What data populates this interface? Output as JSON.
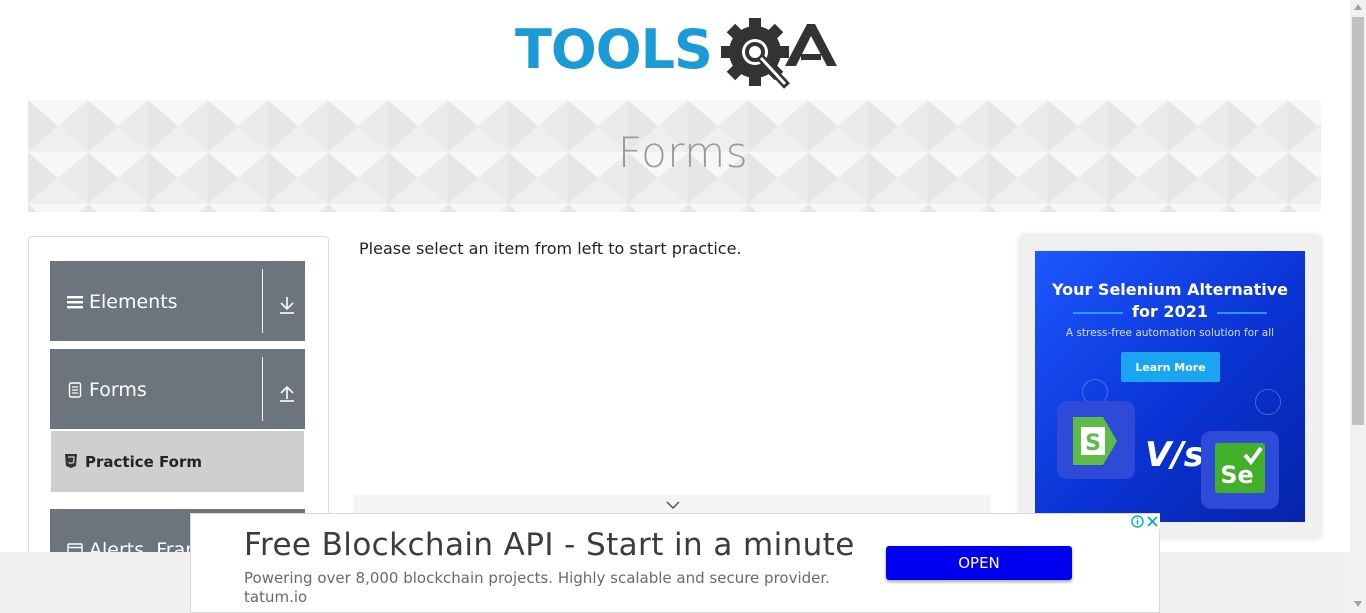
{
  "logo": {
    "text": "TOOLSQA",
    "icon": "toolsqa-logo"
  },
  "banner": {
    "title": "Forms"
  },
  "sidebar": {
    "groups": [
      {
        "label": "Elements",
        "icon": "hamburger-icon",
        "arrow": "download-arrow-icon"
      },
      {
        "label": "Forms",
        "icon": "document-icon",
        "arrow": "upload-arrow-icon"
      },
      {
        "label": "Alerts, Frame & Windows",
        "icon": "window-icon"
      }
    ],
    "active_item": {
      "label": "Practice Form",
      "icon": "html5-icon"
    }
  },
  "main": {
    "instruction": "Please select an item from left to start practice."
  },
  "ad_right": {
    "title_line1": "Your Selenium Alternative",
    "title_line2": "for 2021",
    "subtitle": "A stress-free automation solution for all",
    "button_label": "Learn More",
    "vs_text": "V/s",
    "accent_color": "#19a5ef",
    "bg_color": "#0a33d4"
  },
  "ad_bottom": {
    "headline": "Free Blockchain API - Start in a minute",
    "description": "Powering over 8,000 blockchain projects. Highly scalable and secure provider.",
    "domain": "tatum.io",
    "button_label": "OPEN",
    "button_color": "#0000f0"
  },
  "colors": {
    "sidebar_header": "#6c757d",
    "active_item_bg": "#cfcfcf",
    "logo_blue": "#1a9ad6",
    "logo_dark": "#333333"
  }
}
